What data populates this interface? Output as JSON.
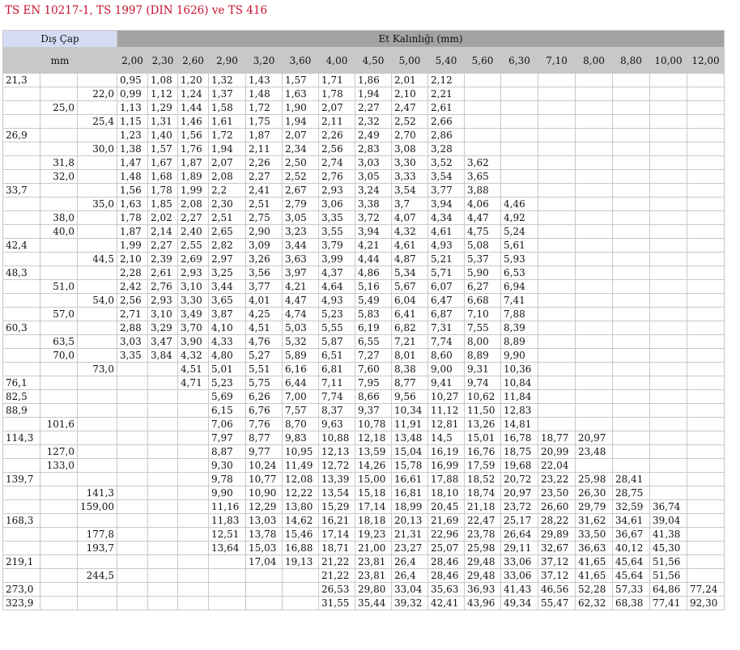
{
  "title": "TS EN 10217-1, TS 1997 (DIN 1626) ve TS 416",
  "header": {
    "dis_cap": "Dış Çap",
    "et_kalinligi": "Et Kalınlığı (mm)",
    "unit": "mm"
  },
  "thickness": [
    "2,00",
    "2,30",
    "2,60",
    "2,90",
    "3,20",
    "3,60",
    "4,00",
    "4,50",
    "5,00",
    "5,40",
    "5,60",
    "6,30",
    "7,10",
    "8,00",
    "8,80",
    "10,00",
    "12,00"
  ],
  "rows": [
    {
      "d": [
        "21,3",
        "",
        ""
      ],
      "v": [
        "0,95",
        "1,08",
        "1,20",
        "1,32",
        "1,43",
        "1,57",
        "1,71",
        "1,86",
        "2,01",
        "2,12",
        "",
        "",
        "",
        "",
        "",
        "",
        ""
      ]
    },
    {
      "d": [
        "",
        "",
        "22,0"
      ],
      "v": [
        "0,99",
        "1,12",
        "1,24",
        "1,37",
        "1,48",
        "1,63",
        "1,78",
        "1,94",
        "2,10",
        "2,21",
        "",
        "",
        "",
        "",
        "",
        "",
        ""
      ]
    },
    {
      "d": [
        "",
        "25,0",
        ""
      ],
      "v": [
        "1,13",
        "1,29",
        "1,44",
        "1,58",
        "1,72",
        "1,90",
        "2,07",
        "2,27",
        "2,47",
        "2,61",
        "",
        "",
        "",
        "",
        "",
        "",
        ""
      ]
    },
    {
      "d": [
        "",
        "",
        "25,4"
      ],
      "v": [
        "1,15",
        "1,31",
        "1,46",
        "1,61",
        "1,75",
        "1,94",
        "2,11",
        "2,32",
        "2,52",
        "2,66",
        "",
        "",
        "",
        "",
        "",
        "",
        ""
      ]
    },
    {
      "d": [
        "26,9",
        "",
        ""
      ],
      "v": [
        "1,23",
        "1,40",
        "1,56",
        "1,72",
        "1,87",
        "2,07",
        "2,26",
        "2,49",
        "2,70",
        "2,86",
        "",
        "",
        "",
        "",
        "",
        "",
        ""
      ]
    },
    {
      "d": [
        "",
        "",
        "30,0"
      ],
      "v": [
        "1,38",
        "1,57",
        "1,76",
        "1,94",
        "2,11",
        "2,34",
        "2,56",
        "2,83",
        "3,08",
        "3,28",
        "",
        "",
        "",
        "",
        "",
        "",
        ""
      ]
    },
    {
      "d": [
        "",
        "31,8",
        ""
      ],
      "v": [
        "1,47",
        "1,67",
        "1,87",
        "2,07",
        "2,26",
        "2,50",
        "2,74",
        "3,03",
        "3,30",
        "3,52",
        "3,62",
        "",
        "",
        "",
        "",
        "",
        ""
      ]
    },
    {
      "d": [
        "",
        "32,0",
        ""
      ],
      "v": [
        "1,48",
        "1,68",
        "1,89",
        "2,08",
        "2,27",
        "2,52",
        "2,76",
        "3,05",
        "3,33",
        "3,54",
        "3,65",
        "",
        "",
        "",
        "",
        "",
        ""
      ]
    },
    {
      "d": [
        "33,7",
        "",
        ""
      ],
      "v": [
        "1,56",
        "1,78",
        "1,99",
        "2,2",
        "2,41",
        "2,67",
        "2,93",
        "3,24",
        "3,54",
        "3,77",
        "3,88",
        "",
        "",
        "",
        "",
        "",
        ""
      ]
    },
    {
      "d": [
        "",
        "",
        "35,0"
      ],
      "v": [
        "1,63",
        "1,85",
        "2,08",
        "2,30",
        "2,51",
        "2,79",
        "3,06",
        "3,38",
        "3,7",
        "3,94",
        "4,06",
        "4,46",
        "",
        "",
        "",
        "",
        ""
      ]
    },
    {
      "d": [
        "",
        "38,0",
        ""
      ],
      "v": [
        "1,78",
        "2,02",
        "2,27",
        "2,51",
        "2,75",
        "3,05",
        "3,35",
        "3,72",
        "4,07",
        "4,34",
        "4,47",
        "4,92",
        "",
        "",
        "",
        "",
        ""
      ]
    },
    {
      "d": [
        "",
        "40,0",
        ""
      ],
      "v": [
        "1,87",
        "2,14",
        "2,40",
        "2,65",
        "2,90",
        "3,23",
        "3,55",
        "3,94",
        "4,32",
        "4,61",
        "4,75",
        "5,24",
        "",
        "",
        "",
        "",
        ""
      ]
    },
    {
      "d": [
        "42,4",
        "",
        ""
      ],
      "v": [
        "1,99",
        "2,27",
        "2,55",
        "2,82",
        "3,09",
        "3,44",
        "3,79",
        "4,21",
        "4,61",
        "4,93",
        "5,08",
        "5,61",
        "",
        "",
        "",
        "",
        ""
      ]
    },
    {
      "d": [
        "",
        "",
        "44,5"
      ],
      "v": [
        "2,10",
        "2,39",
        "2,69",
        "2,97",
        "3,26",
        "3,63",
        "3,99",
        "4,44",
        "4,87",
        "5,21",
        "5,37",
        "5,93",
        "",
        "",
        "",
        "",
        ""
      ]
    },
    {
      "d": [
        "48,3",
        "",
        ""
      ],
      "v": [
        "2,28",
        "2,61",
        "2,93",
        "3,25",
        "3,56",
        "3,97",
        "4,37",
        "4,86",
        "5,34",
        "5,71",
        "5,90",
        "6,53",
        "",
        "",
        "",
        "",
        ""
      ]
    },
    {
      "d": [
        "",
        "51,0",
        ""
      ],
      "v": [
        "2,42",
        "2,76",
        "3,10",
        "3,44",
        "3,77",
        "4,21",
        "4,64",
        "5,16",
        "5,67",
        "6,07",
        "6,27",
        "6,94",
        "",
        "",
        "",
        "",
        ""
      ]
    },
    {
      "d": [
        "",
        "",
        "54,0"
      ],
      "v": [
        "2,56",
        "2,93",
        "3,30",
        "3,65",
        "4,01",
        "4,47",
        "4,93",
        "5,49",
        "6,04",
        "6,47",
        "6,68",
        "7,41",
        "",
        "",
        "",
        "",
        ""
      ]
    },
    {
      "d": [
        "",
        "57,0",
        ""
      ],
      "v": [
        "2,71",
        "3,10",
        "3,49",
        "3,87",
        "4,25",
        "4,74",
        "5,23",
        "5,83",
        "6,41",
        "6,87",
        "7,10",
        "7,88",
        "",
        "",
        "",
        "",
        ""
      ]
    },
    {
      "d": [
        "60,3",
        "",
        ""
      ],
      "v": [
        "2,88",
        "3,29",
        "3,70",
        "4,10",
        "4,51",
        "5,03",
        "5,55",
        "6,19",
        "6,82",
        "7,31",
        "7,55",
        "8,39",
        "",
        "",
        "",
        "",
        ""
      ]
    },
    {
      "d": [
        "",
        "63,5",
        ""
      ],
      "v": [
        "3,03",
        "3,47",
        "3,90",
        "4,33",
        "4,76",
        "5,32",
        "5,87",
        "6,55",
        "7,21",
        "7,74",
        "8,00",
        "8,89",
        "",
        "",
        "",
        "",
        ""
      ]
    },
    {
      "d": [
        "",
        "70,0",
        ""
      ],
      "v": [
        "3,35",
        "3,84",
        "4,32",
        "4,80",
        "5,27",
        "5,89",
        "6,51",
        "7,27",
        "8,01",
        "8,60",
        "8,89",
        "9,90",
        "",
        "",
        "",
        "",
        ""
      ]
    },
    {
      "d": [
        "",
        "",
        "73,0"
      ],
      "v": [
        "",
        "",
        "4,51",
        "5,01",
        "5,51",
        "6,16",
        "6,81",
        "7,60",
        "8,38",
        "9,00",
        "9,31",
        "10,36",
        "",
        "",
        "",
        "",
        ""
      ]
    },
    {
      "d": [
        "76,1",
        "",
        ""
      ],
      "v": [
        "",
        "",
        "4,71",
        "5,23",
        "5,75",
        "6,44",
        "7,11",
        "7,95",
        "8,77",
        "9,41",
        "9,74",
        "10,84",
        "",
        "",
        "",
        "",
        ""
      ]
    },
    {
      "d": [
        "82,5",
        "",
        ""
      ],
      "v": [
        "",
        "",
        "",
        "5,69",
        "6,26",
        "7,00",
        "7,74",
        "8,66",
        "9,56",
        "10,27",
        "10,62",
        "11,84",
        "",
        "",
        "",
        "",
        ""
      ]
    },
    {
      "d": [
        "88,9",
        "",
        ""
      ],
      "v": [
        "",
        "",
        "",
        "6,15",
        "6,76",
        "7,57",
        "8,37",
        "9,37",
        "10,34",
        "11,12",
        "11,50",
        "12,83",
        "",
        "",
        "",
        "",
        ""
      ]
    },
    {
      "d": [
        "",
        "101,6",
        ""
      ],
      "v": [
        "",
        "",
        "",
        "7,06",
        "7,76",
        "8,70",
        "9,63",
        "10,78",
        "11,91",
        "12,81",
        "13,26",
        "14,81",
        "",
        "",
        "",
        "",
        ""
      ]
    },
    {
      "d": [
        "114,3",
        "",
        ""
      ],
      "v": [
        "",
        "",
        "",
        "7,97",
        "8,77",
        "9,83",
        "10,88",
        "12,18",
        "13,48",
        "14,5",
        "15,01",
        "16,78",
        "18,77",
        "20,97",
        "",
        "",
        ""
      ]
    },
    {
      "d": [
        "",
        "127,0",
        ""
      ],
      "v": [
        "",
        "",
        "",
        "8,87",
        "9,77",
        "10,95",
        "12,13",
        "13,59",
        "15,04",
        "16,19",
        "16,76",
        "18,75",
        "20,99",
        "23,48",
        "",
        "",
        ""
      ]
    },
    {
      "d": [
        "",
        "133,0",
        ""
      ],
      "v": [
        "",
        "",
        "",
        "9,30",
        "10,24",
        "11,49",
        "12,72",
        "14,26",
        "15,78",
        "16,99",
        "17,59",
        "19,68",
        "22,04",
        "",
        "",
        "",
        ""
      ]
    },
    {
      "d": [
        "139,7",
        "",
        ""
      ],
      "v": [
        "",
        "",
        "",
        "9,78",
        "10,77",
        "12,08",
        "13,39",
        "15,00",
        "16,61",
        "17,88",
        "18,52",
        "20,72",
        "23,22",
        "25,98",
        "28,41",
        "",
        ""
      ]
    },
    {
      "d": [
        "",
        "",
        "141,3"
      ],
      "v": [
        "",
        "",
        "",
        "9,90",
        "10,90",
        "12,22",
        "13,54",
        "15,18",
        "16,81",
        "18,10",
        "18,74",
        "20,97",
        "23,50",
        "26,30",
        "28,75",
        "",
        ""
      ]
    },
    {
      "d": [
        "",
        "",
        "159,00"
      ],
      "v": [
        "",
        "",
        "",
        "11,16",
        "12,29",
        "13,80",
        "15,29",
        "17,14",
        "18,99",
        "20,45",
        "21,18",
        "23,72",
        "26,60",
        "29,79",
        "32,59",
        "36,74",
        ""
      ]
    },
    {
      "d": [
        "168,3",
        "",
        ""
      ],
      "v": [
        "",
        "",
        "",
        "11,83",
        "13,03",
        "14,62",
        "16,21",
        "18,18",
        "20,13",
        "21,69",
        "22,47",
        "25,17",
        "28,22",
        "31,62",
        "34,61",
        "39,04",
        ""
      ]
    },
    {
      "d": [
        "",
        "",
        "177,8"
      ],
      "v": [
        "",
        "",
        "",
        "12,51",
        "13,78",
        "15,46",
        "17,14",
        "19,23",
        "21,31",
        "22,96",
        "23,78",
        "26,64",
        "29,89",
        "33,50",
        "36,67",
        "41,38",
        ""
      ]
    },
    {
      "d": [
        "",
        "",
        "193,7"
      ],
      "v": [
        "",
        "",
        "",
        "13,64",
        "15,03",
        "16,88",
        "18,71",
        "21,00",
        "23,27",
        "25,07",
        "25,98",
        "29,11",
        "32,67",
        "36,63",
        "40,12",
        "45,30",
        ""
      ]
    },
    {
      "d": [
        "219,1",
        "",
        ""
      ],
      "v": [
        "",
        "",
        "",
        "",
        "17,04",
        "19,13",
        "21,22",
        "23,81",
        "26,4",
        "28,46",
        "29,48",
        "33,06",
        "37,12",
        "41,65",
        "45,64",
        "51,56",
        ""
      ]
    },
    {
      "d": [
        "",
        "",
        "244,5"
      ],
      "v": [
        "",
        "",
        "",
        "",
        "",
        "",
        "21,22",
        "23,81",
        "26,4",
        "28,46",
        "29,48",
        "33,06",
        "37,12",
        "41,65",
        "45,64",
        "51,56",
        ""
      ]
    },
    {
      "d": [
        "273,0",
        "",
        ""
      ],
      "v": [
        "",
        "",
        "",
        "",
        "",
        "",
        "26,53",
        "29,80",
        "33,04",
        "35,63",
        "36,93",
        "41,43",
        "46,56",
        "52,28",
        "57,33",
        "64,86",
        "77,24"
      ]
    },
    {
      "d": [
        "323,9",
        "",
        ""
      ],
      "v": [
        "",
        "",
        "",
        "",
        "",
        "",
        "31,55",
        "35,44",
        "39,32",
        "42,41",
        "43,96",
        "49,34",
        "55,47",
        "62,32",
        "68,38",
        "77,41",
        "92,30"
      ]
    }
  ]
}
